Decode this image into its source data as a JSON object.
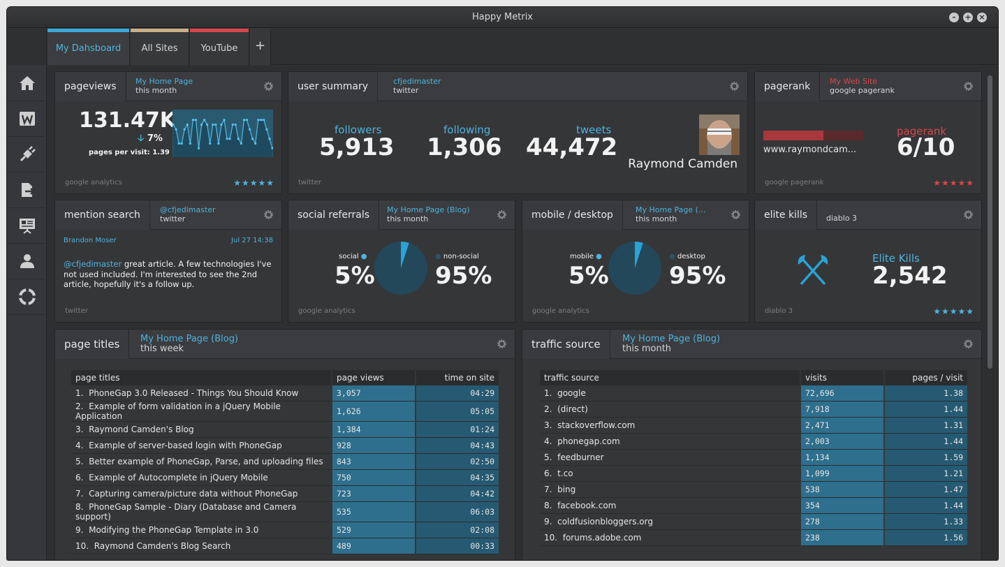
{
  "window": {
    "title": "Happy Metrix"
  },
  "tabs": [
    {
      "label": "My Dahsboard",
      "color": "#3ba9d8"
    },
    {
      "label": "All Sites",
      "color": "#c9b08a"
    },
    {
      "label": "YouTube",
      "color": "#d8474a"
    },
    {
      "label": "+"
    }
  ],
  "sidebar": [
    "home-icon",
    "wordpress-icon",
    "plug-icon",
    "export-icon",
    "presentation-icon",
    "user-icon",
    "lifebuoy-icon"
  ],
  "pageviews": {
    "title": "pageviews",
    "site": "My Home Page",
    "period": "this month",
    "value": "131.47K",
    "change": "7%",
    "arrow": "🡣",
    "ppv": "pages per visit: 1.39",
    "footer": "google analytics",
    "stars": "★★★★★",
    "spark": [
      6,
      5,
      2,
      2,
      5,
      6,
      2,
      7,
      7,
      1,
      6,
      7,
      6,
      2,
      6,
      6,
      2,
      6,
      7,
      3,
      3,
      6,
      6,
      3,
      2,
      7,
      7,
      5,
      3,
      2,
      7,
      7,
      7,
      5,
      3,
      1
    ]
  },
  "user_summary": {
    "title": "user summary",
    "account": "cfjedimaster",
    "service": "twitter",
    "followers_label": "followers",
    "followers": "5,913",
    "following_label": "following",
    "following": "1,306",
    "tweets_label": "tweets",
    "tweets": "44,472",
    "name": "Raymond Camden",
    "footer": "twitter"
  },
  "pagerank": {
    "title": "pagerank",
    "site": "My Web Site",
    "service": "google pagerank",
    "url": "www.raymondcam...",
    "label": "pagerank",
    "value": "6/10",
    "progress": 0.6,
    "footer": "google pagerank",
    "stars": "★★★★★"
  },
  "mention": {
    "title": "mention search",
    "account": "@cfjedimaster",
    "service": "twitter",
    "author": "Brandon Moser",
    "date": "Jul 27 14:38",
    "handle": "@cfjedimaster",
    "text": " great article. A few technologies I've not used included. I'm interested to see the 2nd article, hopefully it's a follow up.",
    "footer": "twitter"
  },
  "social": {
    "title": "social referrals",
    "site": "My Home Page (Blog)",
    "period": "this month",
    "left_label": "social",
    "left_value": "5%",
    "right_label": "non-social",
    "right_value": "95%",
    "share": 0.05,
    "footer": "google analytics"
  },
  "mobile": {
    "title": "mobile / desktop",
    "site": "My Home Page (...",
    "period": "this month",
    "left_label": "mobile",
    "left_value": "5%",
    "right_label": "desktop",
    "right_value": "95%",
    "share": 0.05,
    "footer": "google analytics"
  },
  "elite": {
    "title": "elite kills",
    "game": "diablo 3",
    "label": "Elite Kills",
    "value": "2,542",
    "footer": "diablo 3",
    "stars": "★★★★★"
  },
  "page_titles": {
    "title": "page titles",
    "site": "My Home Page (Blog)",
    "period": "this week",
    "columns": [
      "page titles",
      "page views",
      "time on site"
    ],
    "rows": [
      [
        "1.",
        "PhoneGap 3.0 Released - Things You Should Know",
        "3,057",
        "04:29"
      ],
      [
        "2.",
        "Example of form validation in a jQuery Mobile Application",
        "1,626",
        "05:05"
      ],
      [
        "3.",
        "Raymond Camden's Blog",
        "1,384",
        "01:24"
      ],
      [
        "4.",
        "Example of server-based login with PhoneGap",
        "928",
        "04:43"
      ],
      [
        "5.",
        "Better example of PhoneGap, Parse, and uploading files",
        "843",
        "02:50"
      ],
      [
        "6.",
        "Example of Autocomplete in jQuery Mobile",
        "750",
        "04:35"
      ],
      [
        "7.",
        "Capturing camera/picture data without PhoneGap",
        "723",
        "04:42"
      ],
      [
        "8.",
        "PhoneGap Sample - Diary (Database and Camera support)",
        "535",
        "06:03"
      ],
      [
        "9.",
        "Modifying the PhoneGap Template in 3.0",
        "529",
        "02:08"
      ],
      [
        "10.",
        "Raymond Camden's Blog Search",
        "489",
        "00:33"
      ]
    ]
  },
  "traffic": {
    "title": "traffic source",
    "site": "My Home Page (Blog)",
    "period": "this month",
    "columns": [
      "traffic source",
      "visits",
      "pages / visit"
    ],
    "rows": [
      [
        "1.",
        "google",
        "72,696",
        "1.38"
      ],
      [
        "2.",
        "(direct)",
        "7,918",
        "1.44"
      ],
      [
        "3.",
        "stackoverflow.com",
        "2,471",
        "1.31"
      ],
      [
        "4.",
        "phonegap.com",
        "2,003",
        "1.44"
      ],
      [
        "5.",
        "feedburner",
        "1,134",
        "1.59"
      ],
      [
        "6.",
        "t.co",
        "1,099",
        "1.21"
      ],
      [
        "7.",
        "bing",
        "538",
        "1.47"
      ],
      [
        "8.",
        "facebook.com",
        "354",
        "1.44"
      ],
      [
        "9.",
        "coldfusionbloggers.org",
        "278",
        "1.33"
      ],
      [
        "10.",
        "forums.adobe.com",
        "238",
        "1.56"
      ]
    ]
  },
  "colors": {
    "accent": "#4eb3de",
    "red": "#d8474a"
  }
}
